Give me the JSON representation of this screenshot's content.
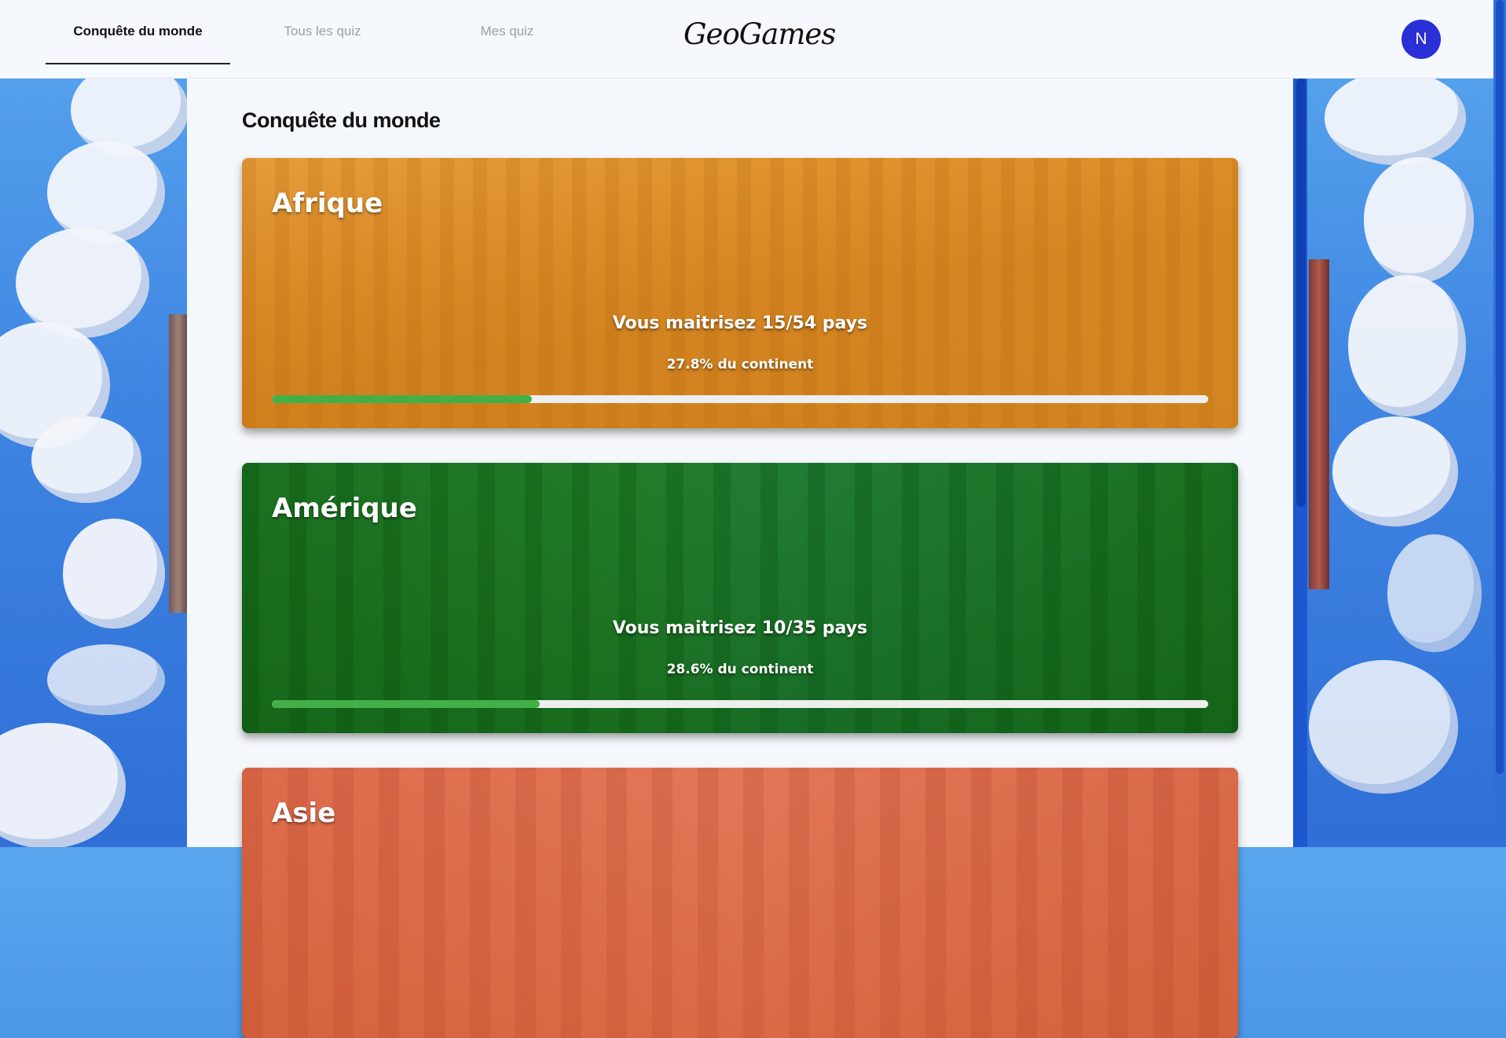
{
  "nav": {
    "tabs": [
      {
        "label": "Conquête du monde",
        "active": true
      },
      {
        "label": "Tous les quiz",
        "active": false
      },
      {
        "label": "Mes quiz",
        "active": false
      }
    ],
    "logo": "GeoGames",
    "avatar_initial": "N"
  },
  "main": {
    "title": "Conquête du monde",
    "cards": [
      {
        "title": "Afrique",
        "status": "Vous maitrisez 15/54 pays",
        "percent_label": "27.8% du continent",
        "progress": 0.278,
        "tint": "#d98a1c"
      },
      {
        "title": "Amérique",
        "status": "Vous maitrisez 10/35 pays",
        "percent_label": "28.6% du continent",
        "progress": 0.286,
        "tint": "#1b6b1b"
      },
      {
        "title": "Asie",
        "status": "",
        "percent_label": "",
        "progress": null,
        "tint": "#d8643f"
      }
    ]
  },
  "colors": {
    "progress_fill": "#43b047",
    "progress_track": "#eeeeee",
    "avatar_bg": "#2a2fd6"
  }
}
